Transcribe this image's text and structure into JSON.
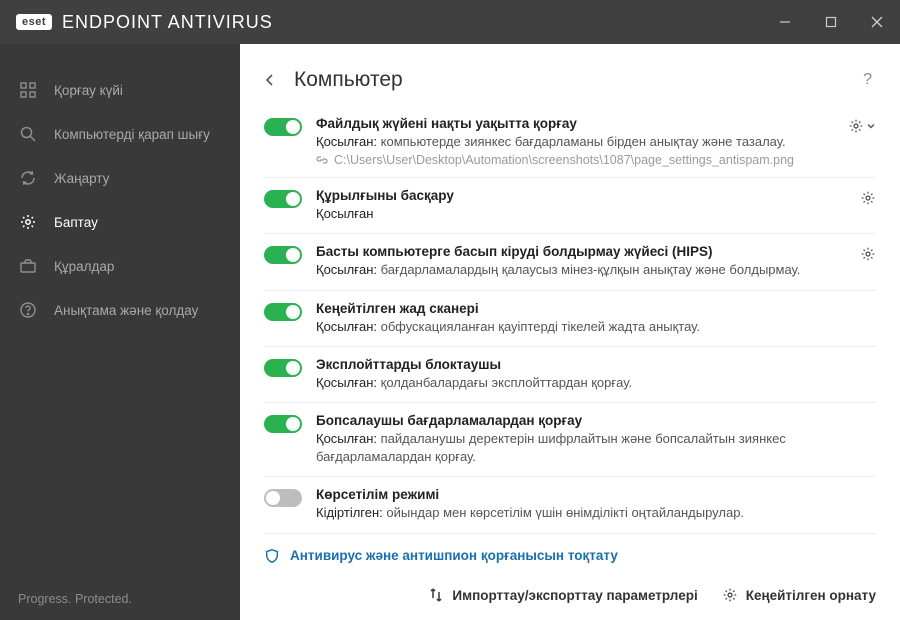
{
  "brand": {
    "badge": "eset",
    "product": "ENDPOINT ANTIVIRUS"
  },
  "sidebar": {
    "items": [
      {
        "label": "Қорғау күйі"
      },
      {
        "label": "Компьютерді қарап шығу"
      },
      {
        "label": "Жаңарту"
      },
      {
        "label": "Баптау"
      },
      {
        "label": "Құралдар"
      },
      {
        "label": "Анықтама және қолдау"
      }
    ],
    "footer": "Progress. Protected."
  },
  "page": {
    "title": "Компьютер"
  },
  "rows": [
    {
      "title": "Файлдық жүйені нақты уақытта қорғау",
      "state": "Қосылған:",
      "desc": "компьютерде зиянкес бағдарламаны бірден анықтау және тазалау.",
      "extra": "C:\\Users\\User\\Desktop\\Automation\\screenshots\\1087\\page_settings_antispam.png"
    },
    {
      "title": "Құрылғыны басқару",
      "state": "Қосылған",
      "desc": ""
    },
    {
      "title": "Басты компьютерге басып кіруді болдырмау жүйесі (HIPS)",
      "state": "Қосылған:",
      "desc": "бағдарламалардың қалаусыз мінез-құлқын анықтау және болдырмау."
    },
    {
      "title": "Кеңейтілген жад сканері",
      "state": "Қосылған:",
      "desc": "обфускацияланған қауіптерді тікелей жадта анықтау."
    },
    {
      "title": "Эксплойттарды блоктаушы",
      "state": "Қосылған:",
      "desc": "қолданбалардағы эксплойттардан қорғау."
    },
    {
      "title": "Бопсалаушы бағдарламалардан қорғау",
      "state": "Қосылған:",
      "desc": "пайдаланушы деректерін шифрлайтын және бопсалайтын зиянкес бағдарламалардан қорғау."
    },
    {
      "title": "Көрсетілім режимі",
      "state": "Кідіртілген:",
      "desc": "ойындар мен көрсетілім үшін өнімділікті оңтайландырулар."
    }
  ],
  "pause_link": "Антивирус және антишпион қорғанысын тоқтату",
  "bottom": {
    "import_export": "Импорттау/экспорттау параметрлері",
    "advanced": "Кеңейтілген орнату"
  }
}
